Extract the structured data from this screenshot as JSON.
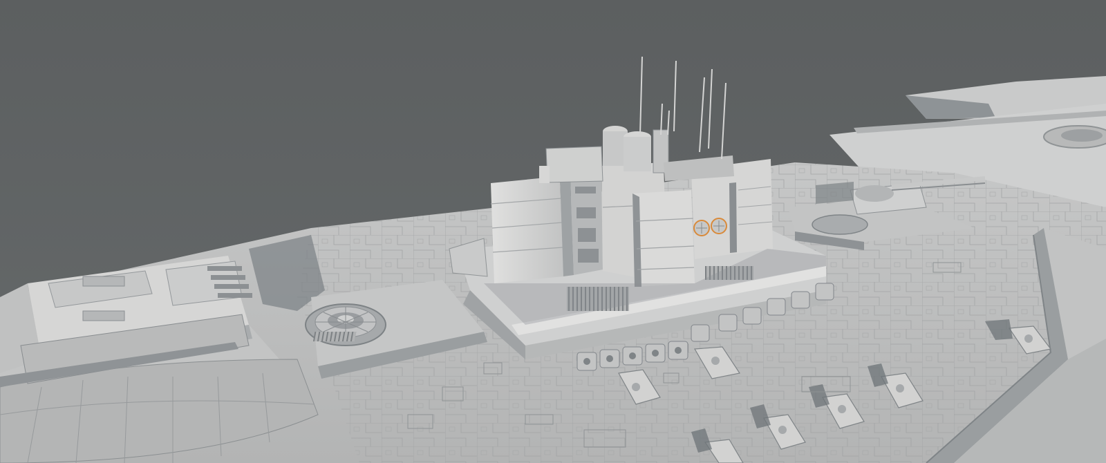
{
  "scene": {
    "subject": "",
    "colors": {
      "sky": "#5f6263",
      "deck_light": "#cfd0d0",
      "deck_mid": "#b9babb",
      "deck_shadow": "#868b8f",
      "panel_line": "#9a9c9d",
      "building_light": "#d9d9d8",
      "building_mid": "#bdbebe",
      "building_dark": "#8e9295",
      "accent_orange": "#d98a3a"
    }
  }
}
